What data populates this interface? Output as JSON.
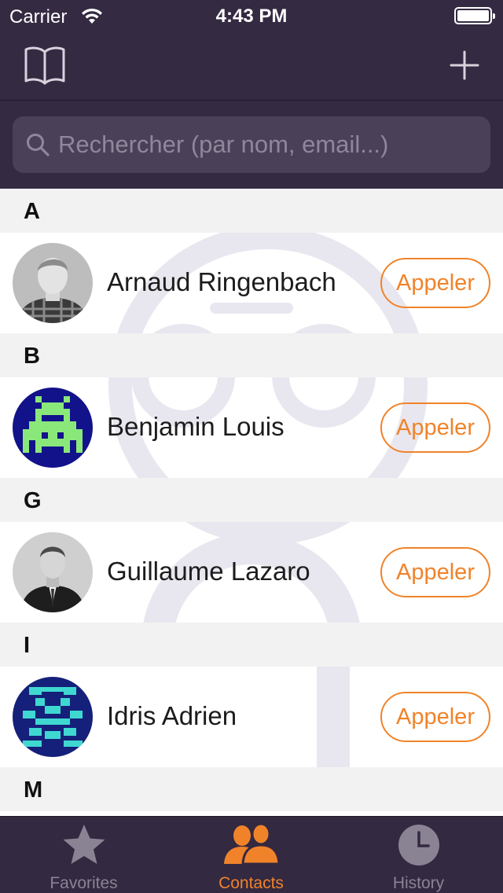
{
  "status_bar": {
    "carrier": "Carrier",
    "time": "4:43 PM"
  },
  "navbar": {
    "left_icon": "book-icon",
    "right_icon": "plus-icon"
  },
  "search": {
    "placeholder": "Rechercher (par nom, email...)",
    "value": ""
  },
  "sections": [
    {
      "letter": "A",
      "contacts": [
        {
          "name": "Arnaud Ringenbach",
          "action": "Appeler",
          "avatar": "photo"
        }
      ]
    },
    {
      "letter": "B",
      "contacts": [
        {
          "name": "Benjamin Louis",
          "action": "Appeler",
          "avatar": "pixel-invader"
        }
      ]
    },
    {
      "letter": "G",
      "contacts": [
        {
          "name": "Guillaume Lazaro",
          "action": "Appeler",
          "avatar": "photo"
        }
      ]
    },
    {
      "letter": "I",
      "contacts": [
        {
          "name": "Idris Adrien",
          "action": "Appeler",
          "avatar": "pixel-pattern"
        }
      ]
    },
    {
      "letter": "M",
      "contacts": []
    }
  ],
  "tabs": [
    {
      "label": "Favorites",
      "icon": "star-icon",
      "active": false
    },
    {
      "label": "Contacts",
      "icon": "contacts-icon",
      "active": true
    },
    {
      "label": "History",
      "icon": "clock-icon",
      "active": false
    }
  ],
  "colors": {
    "header_bg": "#342a42",
    "accent": "#f0832a",
    "section_bg": "#f2f2f2",
    "tab_inactive": "#8a8394"
  }
}
